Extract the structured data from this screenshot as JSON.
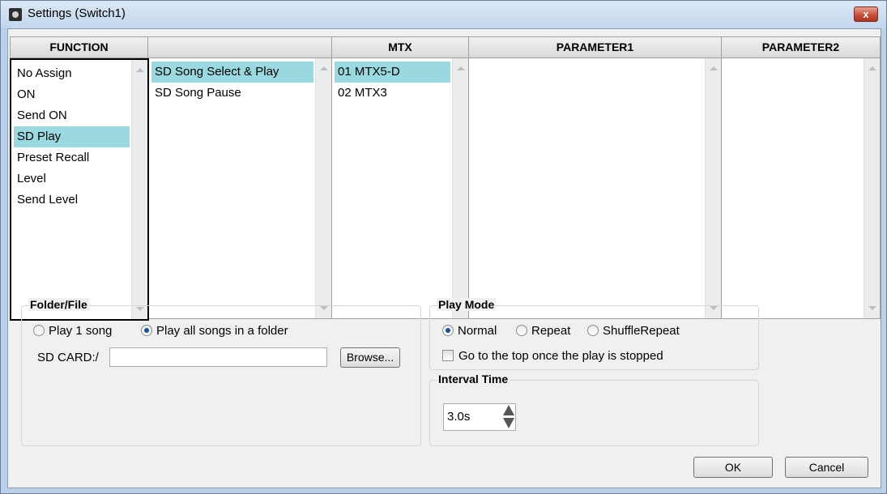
{
  "window": {
    "title": "Settings (Switch1)",
    "close_label": "x"
  },
  "columns": {
    "function_header": "FUNCTION",
    "col2_header": "",
    "mtx_header": "MTX",
    "param1_header": "PARAMETER1",
    "param2_header": "PARAMETER2"
  },
  "function_list": [
    {
      "label": "No Assign",
      "selected": false
    },
    {
      "label": "ON",
      "selected": false
    },
    {
      "label": "Send ON",
      "selected": false
    },
    {
      "label": "SD Play",
      "selected": true
    },
    {
      "label": "Preset Recall",
      "selected": false
    },
    {
      "label": "Level",
      "selected": false
    },
    {
      "label": "Send Level",
      "selected": false
    }
  ],
  "action_list": [
    {
      "label": "SD Song Select & Play",
      "selected": true
    },
    {
      "label": "SD Song Pause",
      "selected": false
    }
  ],
  "mtx_list": [
    {
      "label": "01 MTX5-D",
      "selected": true
    },
    {
      "label": "02 MTX3",
      "selected": false
    }
  ],
  "folder_file": {
    "group_label": "Folder/File",
    "play_one_label": "Play 1 song",
    "play_all_label": "Play all songs in a folder",
    "selected": "play_all",
    "path_label": "SD CARD:/",
    "path_value": "",
    "browse_label": "Browse..."
  },
  "play_mode": {
    "group_label": "Play Mode",
    "normal_label": "Normal",
    "repeat_label": "Repeat",
    "shuffle_label": "ShuffleRepeat",
    "selected": "normal",
    "go_top_label": "Go to the top once the play is stopped",
    "go_top_checked": false
  },
  "interval": {
    "group_label": "Interval Time",
    "value": "3.0s"
  },
  "footer": {
    "ok_label": "OK",
    "cancel_label": "Cancel"
  }
}
